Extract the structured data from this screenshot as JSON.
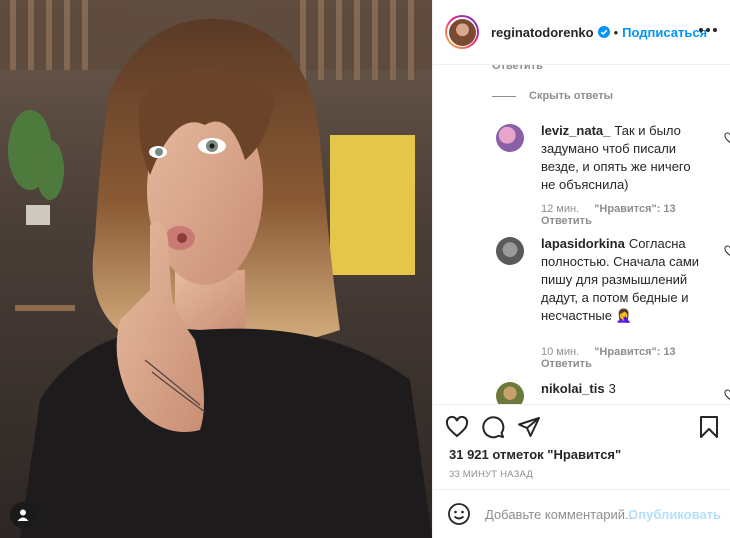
{
  "post": {
    "image_alt": "Photo of woman making a shush gesture",
    "user_tag_icon": "user-icon"
  },
  "header": {
    "username": "reginatodorenko",
    "separator": "•",
    "follow_label": "Подписаться",
    "verified_icon": "verified-badge-icon",
    "more_icon": "more-options-icon"
  },
  "thread": {
    "reply_label_top": "Ответить",
    "hide_replies_label": "Скрыть ответы"
  },
  "comments": [
    {
      "username": "leviz_nata_",
      "text": "Так и было задумано чтоб писали везде, и опять же ничего не объяснила)",
      "time": "12 мин.",
      "likes": "\"Нравится\": 13",
      "reply": "Ответить"
    },
    {
      "username": "lapasidorkina",
      "text": "Согласна полностью. Сначала сами пишу для размышлений дадут, а потом бедные и несчастные 🤦‍♀️",
      "time": "10 мин.",
      "likes": "\"Нравится\": 13",
      "reply": "Ответить"
    },
    {
      "username": "nikolai_tis",
      "text": "3"
    }
  ],
  "actions": {
    "like_icon": "heart-icon",
    "comment_icon": "comment-icon",
    "share_icon": "share-icon",
    "save_icon": "bookmark-icon",
    "likes_count": "31 921 отметок \"Нравится\"",
    "time_ago": "33 МИНУТ НАЗАД"
  },
  "add_comment": {
    "emoji_icon": "emoji-icon",
    "placeholder": "Добавьте комментарий...",
    "publish_label": "Опубликовать"
  },
  "colors": {
    "accent": "#0095f6",
    "publish_disabled": "#b2dffc",
    "muted": "#8e8e8e",
    "text": "#262626"
  }
}
